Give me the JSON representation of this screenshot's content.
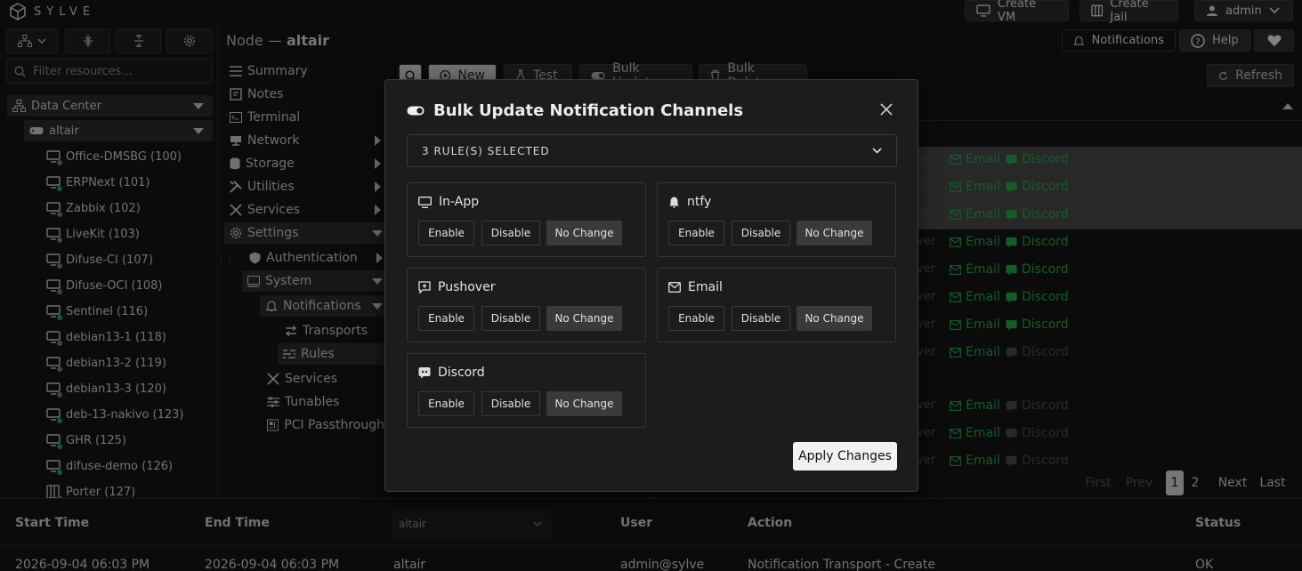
{
  "app": {
    "brand": "SYLVE"
  },
  "topbar": {
    "create_vm": "Create VM",
    "create_jail": "Create Jail",
    "user": "admin",
    "notifications": "Notifications",
    "help": "Help"
  },
  "sidebar": {
    "filter_placeholder": "Filter resources...",
    "datacenter": "Data Center",
    "node": "altair",
    "items": [
      {
        "label": "Office-DMSBG (100)",
        "status": "#7a7a7a"
      },
      {
        "label": "ERPNext (101)",
        "status": "#22a94a"
      },
      {
        "label": "Zabbix (102)",
        "status": "#7a7a7a"
      },
      {
        "label": "LiveKit (103)",
        "status": "#7a7a7a"
      },
      {
        "label": "Difuse-CI (107)",
        "status": "#7a7a7a"
      },
      {
        "label": "Difuse-OCI (108)",
        "status": "#7a7a7a"
      },
      {
        "label": "Sentinel (116)",
        "status": "#22a94a"
      },
      {
        "label": "debian13-1 (118)",
        "status": "#7a7a7a"
      },
      {
        "label": "debian13-2 (119)",
        "status": "#7a7a7a"
      },
      {
        "label": "debian13-3 (120)",
        "status": "#7a7a7a"
      },
      {
        "label": "deb-13-nakivo (123)",
        "status": "#22a94a"
      },
      {
        "label": "GHR (125)",
        "status": "#22a94a"
      },
      {
        "label": "difuse-demo (126)",
        "status": "#22a94a"
      },
      {
        "label": "Porter (127)",
        "status": "#22a94a"
      }
    ]
  },
  "node_title": {
    "prefix": "Node — ",
    "name": "altair"
  },
  "nav": {
    "summary": "Summary",
    "notes": "Notes",
    "terminal": "Terminal",
    "network": "Network",
    "storage": "Storage",
    "utilities": "Utilities",
    "services": "Services",
    "settings": "Settings",
    "authentication": "Authentication",
    "system": "System",
    "notifications": "Notifications",
    "transports": "Transports",
    "rules": "Rules",
    "sys_services": "Services",
    "tunables": "Tunables",
    "pci": "PCI Passthrough"
  },
  "toolbar": {
    "new": "New",
    "test": "Test",
    "bulk_update": "Bulk Update",
    "bulk_delete": "Bulk Delete",
    "refresh": "Refresh"
  },
  "table": {
    "over_text": "ver",
    "email": "Email",
    "discord": "Discord"
  },
  "pagination": {
    "first": "First",
    "prev": "Prev",
    "page1": "1",
    "page2": "2",
    "next": "Next",
    "last": "Last"
  },
  "log": {
    "headers": {
      "start": "Start Time",
      "end": "End Time",
      "node_filter": "altair",
      "user": "User",
      "action": "Action",
      "status": "Status"
    },
    "row": {
      "start": "2026-09-04 06:03 PM",
      "end": "2026-09-04 06:03 PM",
      "node": "altair",
      "user": "admin@sylve",
      "action": "Notification Transport - Create",
      "status": "OK"
    }
  },
  "modal": {
    "title": "Bulk Update Notification Channels",
    "selector": "3 RULE(S) SELECTED",
    "enable": "Enable",
    "disable": "Disable",
    "no_change": "No Change",
    "channels": {
      "inapp": "In-App",
      "ntfy": "ntfy",
      "pushover": "Pushover",
      "email": "Email",
      "discord": "Discord"
    },
    "apply": "Apply Changes"
  }
}
